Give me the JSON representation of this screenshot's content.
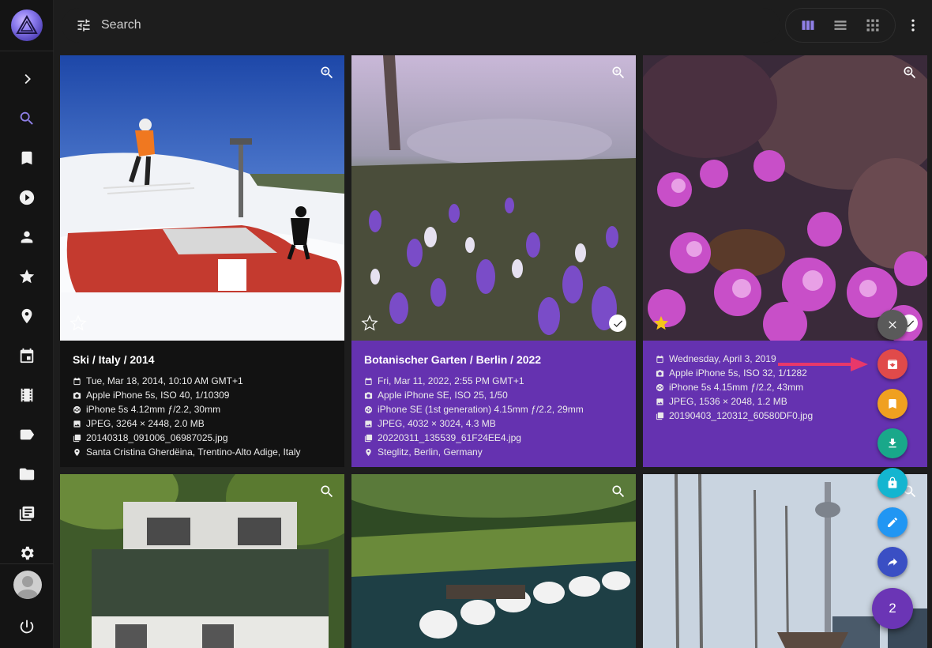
{
  "search": {
    "placeholder": "Search"
  },
  "sidebar": {
    "items": [
      {
        "name": "expand",
        "icon": "chevron-right-icon"
      },
      {
        "name": "search",
        "icon": "search-icon",
        "active": true
      },
      {
        "name": "albums",
        "icon": "bookmark-icon"
      },
      {
        "name": "videos",
        "icon": "play-circle-icon"
      },
      {
        "name": "people",
        "icon": "person-icon"
      },
      {
        "name": "favorites",
        "icon": "star-icon"
      },
      {
        "name": "places",
        "icon": "map-pin-icon"
      },
      {
        "name": "calendar",
        "icon": "calendar-icon"
      },
      {
        "name": "moments",
        "icon": "film-icon"
      },
      {
        "name": "labels",
        "icon": "label-icon"
      },
      {
        "name": "folders",
        "icon": "folder-icon"
      },
      {
        "name": "library",
        "icon": "library-icon"
      },
      {
        "name": "settings",
        "icon": "gear-icon"
      }
    ]
  },
  "view_modes": [
    {
      "name": "cards",
      "icon": "view-columns-icon",
      "active": true
    },
    {
      "name": "list",
      "icon": "view-list-icon"
    },
    {
      "name": "mosaic",
      "icon": "view-grid-icon"
    }
  ],
  "photos": [
    {
      "title": "Ski / Italy / 2014",
      "selected": false,
      "favorite": false,
      "date": "Tue, Mar 18, 2014, 10:10 AM GMT+1",
      "camera": "Apple iPhone 5s, ISO 40, 1/10309",
      "lens": "iPhone 5s 4.12mm ƒ/2.2, 30mm",
      "file": "JPEG, 3264 × 2448, 2.0 MB",
      "filename": "20140318_091006_06987025.jpg",
      "location": "Santa Cristina Gherdëina, Trentino-Alto Adige, Italy"
    },
    {
      "title": "Botanischer Garten / Berlin / 2022",
      "selected": true,
      "favorite": false,
      "date": "Fri, Mar 11, 2022, 2:55 PM GMT+1",
      "camera": "Apple iPhone SE, ISO 25, 1/50",
      "lens": "iPhone SE (1st generation) 4.15mm ƒ/2.2, 29mm",
      "file": "JPEG, 4032 × 3024, 4.3 MB",
      "filename": "20220311_135539_61F24EE4.jpg",
      "location": "Steglitz, Berlin, Germany"
    },
    {
      "title": "",
      "selected": true,
      "favorite": true,
      "date": "Wednesday, April 3, 2019",
      "camera": "Apple iPhone 5s, ISO 32, 1/1282",
      "lens": "iPhone 5s 4.15mm ƒ/2.2, 43mm",
      "file": "JPEG, 1536 × 2048, 1.2 MB",
      "filename": "20190403_120312_60580DF0.jpg",
      "location": ""
    }
  ],
  "fab": {
    "count": "2",
    "actions": [
      {
        "name": "close",
        "icon": "close-icon",
        "color": "#5a5a5a"
      },
      {
        "name": "archive",
        "icon": "archive-icon",
        "color": "#e04a4a"
      },
      {
        "name": "add-to-album",
        "icon": "bookmark-icon",
        "color": "#f0a020"
      },
      {
        "name": "download",
        "icon": "download-icon",
        "color": "#19a88a"
      },
      {
        "name": "private",
        "icon": "lock-icon",
        "color": "#14b5d0"
      },
      {
        "name": "edit",
        "icon": "pencil-icon",
        "color": "#2196f3"
      },
      {
        "name": "share",
        "icon": "share-icon",
        "color": "#3a4fc4"
      }
    ]
  },
  "colors": {
    "accent": "#8f7fe6",
    "selected_card": "#6532b0",
    "arrow": "#e8386a"
  }
}
